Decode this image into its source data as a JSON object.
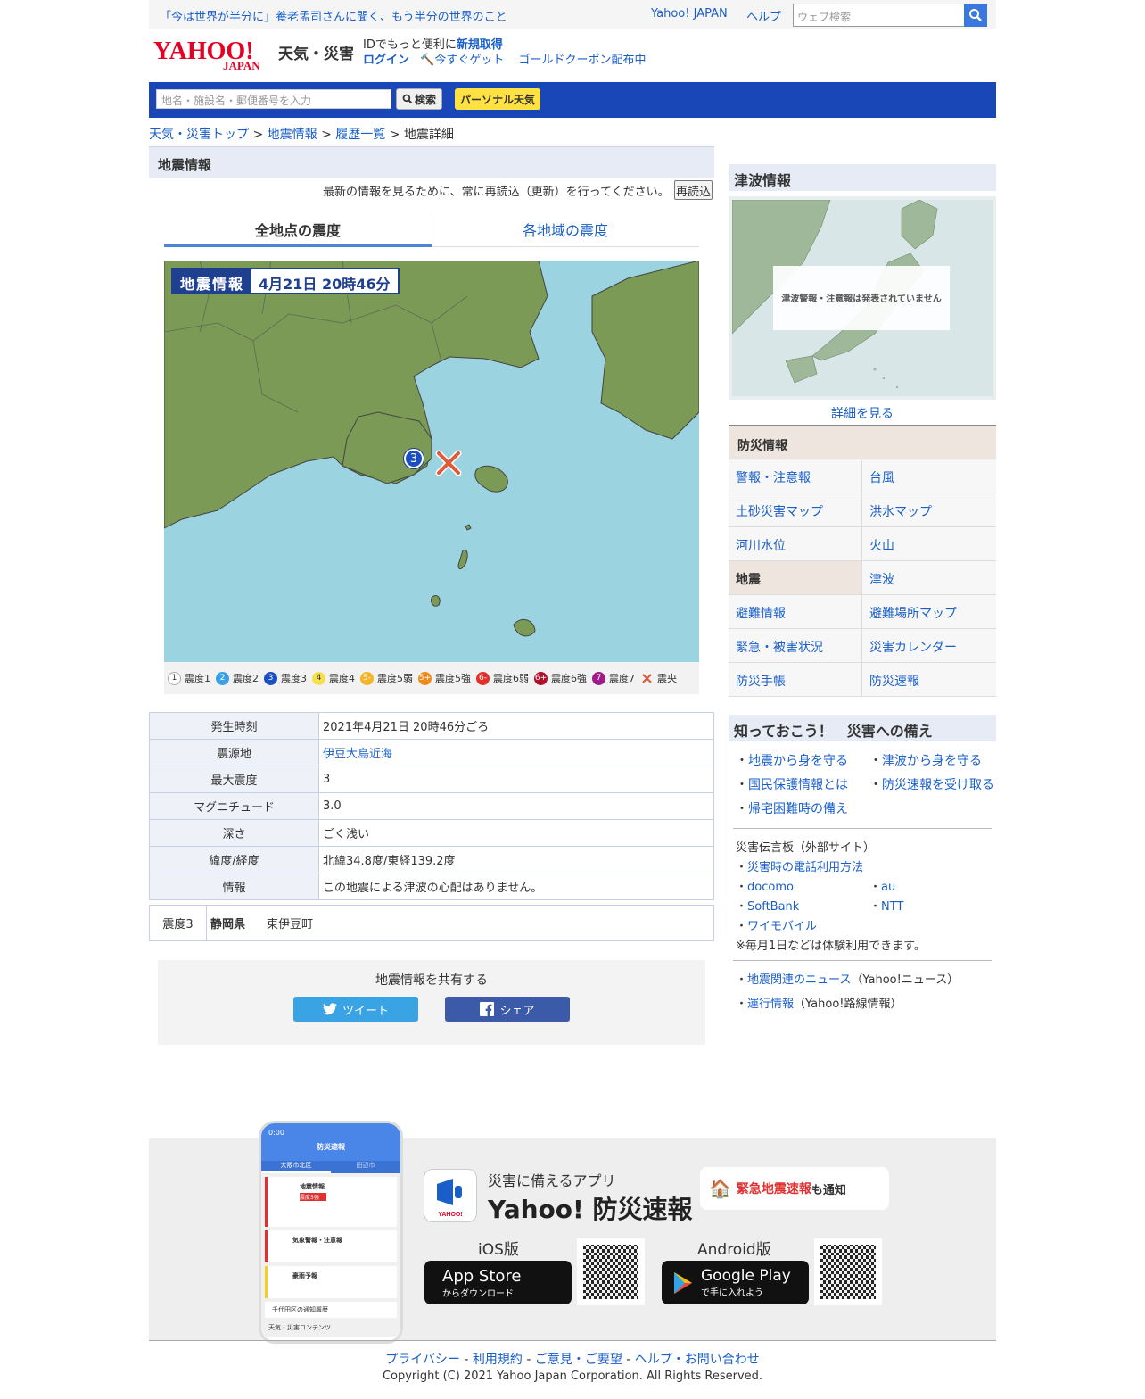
{
  "topbar": {
    "promo": "「今は世界が半分に」養老孟司さんに聞く、もう半分の世界のこと",
    "yahoo_japan": "Yahoo! JAPAN",
    "help": "ヘルプ",
    "search_placeholder": "ウェブ検索"
  },
  "header": {
    "logo": "YAHOO! JAPAN",
    "service": "天気・災害",
    "id_text": "IDでもっと便利に",
    "signup": "新規取得",
    "login": "ログイン",
    "get_now": "今すぐゲット",
    "coupon": "ゴールドクーポン配布中"
  },
  "searchbar": {
    "placeholder": "地名・施設名・郵便番号を入力",
    "search_btn": "検索",
    "personal": "パーソナル天気"
  },
  "breadcrumb": {
    "items": [
      "天気・災害トップ",
      "地震情報",
      "履歴一覧"
    ],
    "current": "地震詳細",
    "sep": ">"
  },
  "main": {
    "title": "地震情報",
    "reload_msg": "最新の情報を見るために、常に再読込（更新）を行ってください。",
    "reload_btn": "再読込",
    "tabs": [
      "全地点の震度",
      "各地域の震度"
    ]
  },
  "map": {
    "label_a": "地震情報",
    "label_b": "4月21日 20時46分",
    "marker": "3",
    "marker_color": "#1a4fc4",
    "epicenter_color": "#e05a3a"
  },
  "legend": [
    {
      "n": "1",
      "label": "震度1",
      "color": "#ffffff"
    },
    {
      "n": "2",
      "label": "震度2",
      "color": "#3aa0e8"
    },
    {
      "n": "3",
      "label": "震度3",
      "color": "#1a4fc4"
    },
    {
      "n": "4",
      "label": "震度4",
      "color": "#f5e04a"
    },
    {
      "n": "5-",
      "label": "震度5弱",
      "color": "#f5b42a"
    },
    {
      "n": "5+",
      "label": "震度5強",
      "color": "#f08a1e"
    },
    {
      "n": "6-",
      "label": "震度6弱",
      "color": "#e0302a"
    },
    {
      "n": "6+",
      "label": "震度6強",
      "color": "#b0102a"
    },
    {
      "n": "7",
      "label": "震度7",
      "color": "#a01a8a"
    },
    {
      "n": "×",
      "label": "震央",
      "color": "#e05a3a"
    }
  ],
  "details": [
    {
      "k": "発生時刻",
      "v": "2021年4月21日 20時46分ごろ"
    },
    {
      "k": "震源地",
      "v": "伊豆大島近海",
      "link": true
    },
    {
      "k": "最大震度",
      "v": "3"
    },
    {
      "k": "マグニチュード",
      "v": "3.0"
    },
    {
      "k": "深さ",
      "v": "ごく浅い"
    },
    {
      "k": "緯度/経度",
      "v": "北緯34.8度/東経139.2度"
    },
    {
      "k": "情報",
      "v": "この地震による津波の心配はありません。"
    }
  ],
  "points": {
    "level": "震度3",
    "pref": "静岡県",
    "city": "東伊豆町"
  },
  "share": {
    "title": "地震情報を共有する",
    "tweet": "ツイート",
    "fb": "シェア"
  },
  "side": {
    "tsunami_title": "津波情報",
    "tsunami_msg": "津波警報・注意報は発表されていません",
    "detail": "詳細を見る",
    "bousai_title": "防災情報",
    "bousai": [
      "警報・注意報",
      "台風",
      "土砂災害マップ",
      "洪水マップ",
      "河川水位",
      "火山",
      "地震",
      "津波",
      "避難情報",
      "避難場所マップ",
      "緊急・被害状況",
      "災害カレンダー",
      "防災手帳",
      "防災速報"
    ],
    "know_title": "知っておこう！　災害への備え",
    "know": [
      "地震から身を守る",
      "津波から身を守る",
      "国民保護情報とは",
      "防災速報を受け取る",
      "帰宅困難時の備え"
    ],
    "dengon_title": "災害伝言板（外部サイト）",
    "dengon_link": "災害時の電話利用方法",
    "carriers": [
      "docomo",
      "au",
      "SoftBank",
      "NTT",
      "ワイモバイル"
    ],
    "note": "※毎月1日などは体験利用できます。",
    "news": "地震関連のニュース",
    "news_src": "（Yahoo!ニュース）",
    "train": "運行情報",
    "train_src": "（Yahoo!路線情報）"
  },
  "banner": {
    "tagline": "災害に備えるアプリ",
    "app": "Yahoo! 防災速報",
    "notify_a": "緊急地震速報",
    "notify_b": "も通知",
    "ios": "iOS版",
    "android": "Android版",
    "appstore_a": "App Store",
    "appstore_b": "からダウンロード",
    "gplay_a": "Google Play",
    "gplay_b": "で手に入れよう",
    "phone_title": "防災速報",
    "phone_tab1": "大阪市北区",
    "phone_tab2": "田辺市",
    "phone_c1": "地震情報",
    "phone_c1b": "震度5強",
    "phone_c2": "気象警報・注意報",
    "phone_c3": "豪雨予報",
    "phone_c4": "千代田区の通知履歴",
    "phone_c5": "天気・災害コンテンツ",
    "phone_time": "0:00"
  },
  "footer": {
    "links": [
      "プライバシー",
      "利用規約",
      "ご意見・ご要望",
      "ヘルプ・お問い合わせ"
    ],
    "copyright": "Copyright (C) 2021 Yahoo Japan Corporation. All Rights Reserved."
  }
}
